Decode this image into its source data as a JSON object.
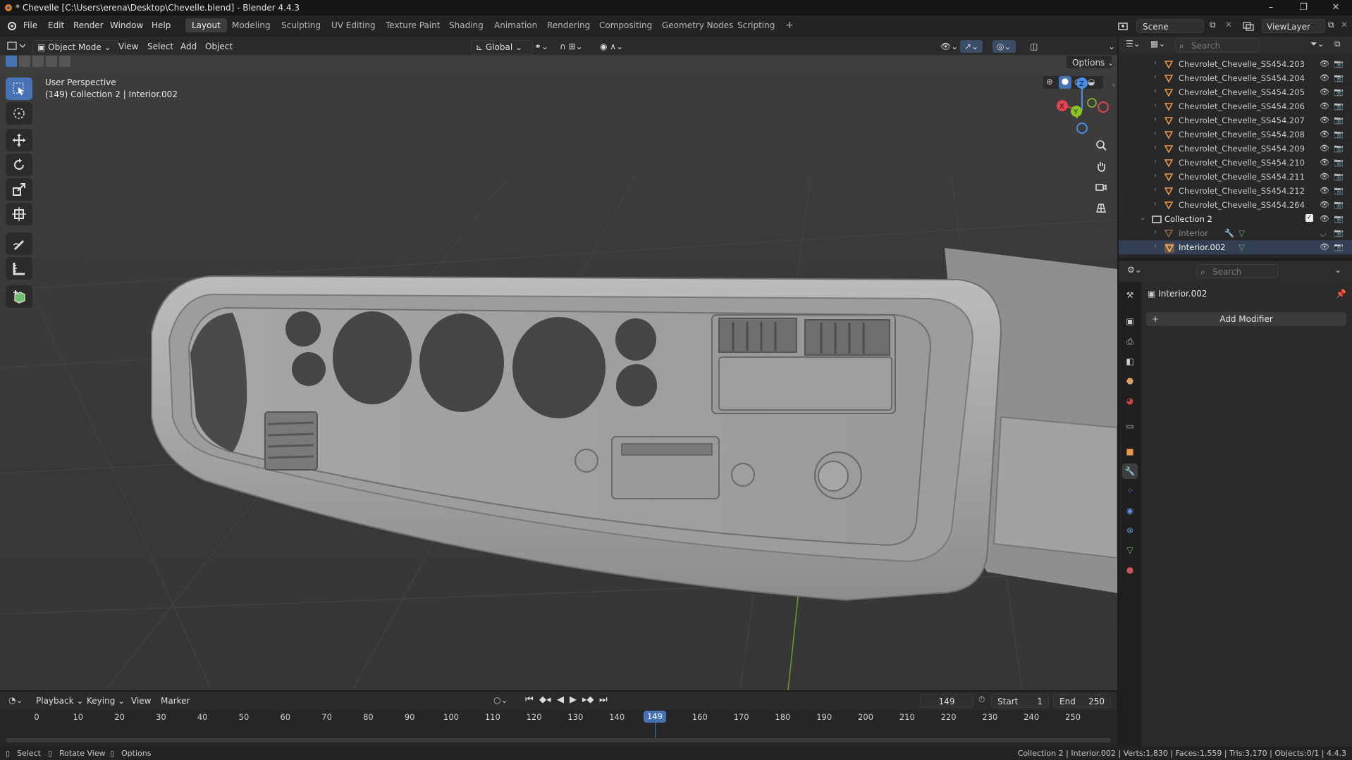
{
  "window": {
    "title": "* Chevelle [C:\\Users\\erena\\Desktop\\Chevelle.blend] - Blender 4.4.3",
    "controls": [
      "–",
      "❐",
      "✕"
    ]
  },
  "topbar": {
    "menus": [
      "File",
      "Edit",
      "Render",
      "Window",
      "Help"
    ],
    "workspaces": [
      "Layout",
      "Modeling",
      "Sculpting",
      "UV Editing",
      "Texture Paint",
      "Shading",
      "Animation",
      "Rendering",
      "Compositing",
      "Geometry Nodes",
      "Scripting"
    ],
    "active_workspace": "Layout",
    "add_workspace": "+",
    "scene_name": "Scene",
    "view_layer": "ViewLayer"
  },
  "viewport": {
    "mode": "Object Mode",
    "menus": [
      "View",
      "Select",
      "Add",
      "Object"
    ],
    "orientation": "Global",
    "options_label": "Options",
    "overlay_line1": "User Perspective",
    "overlay_line2": "(149) Collection 2 | Interior.002",
    "gizmo": {
      "x": "X",
      "y": "Y",
      "z": "Z"
    }
  },
  "outliner": {
    "search_placeholder": "Search",
    "items": [
      {
        "name": "Chevrolet_Chevelle_SS454.203",
        "type": "object"
      },
      {
        "name": "Chevrolet_Chevelle_SS454.204",
        "type": "object"
      },
      {
        "name": "Chevrolet_Chevelle_SS454.205",
        "type": "object"
      },
      {
        "name": "Chevrolet_Chevelle_SS454.206",
        "type": "object"
      },
      {
        "name": "Chevrolet_Chevelle_SS454.207",
        "type": "object"
      },
      {
        "name": "Chevrolet_Chevelle_SS454.208",
        "type": "object"
      },
      {
        "name": "Chevrolet_Chevelle_SS454.209",
        "type": "object"
      },
      {
        "name": "Chevrolet_Chevelle_SS454.210",
        "type": "object"
      },
      {
        "name": "Chevrolet_Chevelle_SS454.211",
        "type": "object"
      },
      {
        "name": "Chevrolet_Chevelle_SS454.212",
        "type": "object"
      },
      {
        "name": "Chevrolet_Chevelle_SS454.264",
        "type": "object"
      },
      {
        "name": "Collection 2",
        "type": "collection"
      },
      {
        "name": "Interior",
        "type": "object-hidden"
      },
      {
        "name": "Interior.002",
        "type": "object-active"
      }
    ]
  },
  "properties": {
    "search_placeholder": "Search",
    "object_name": "Interior.002",
    "add_modifier": "Add Modifier"
  },
  "timeline": {
    "menus": [
      "Playback",
      "Keying",
      "View",
      "Marker"
    ],
    "current_frame": "149",
    "start_label": "Start",
    "start_value": "1",
    "end_label": "End",
    "end_value": "250",
    "ticks": [
      "0",
      "10",
      "20",
      "30",
      "40",
      "50",
      "60",
      "70",
      "80",
      "90",
      "100",
      "110",
      "120",
      "130",
      "140",
      "160",
      "170",
      "180",
      "190",
      "200",
      "210",
      "220",
      "230",
      "240",
      "250"
    ],
    "playhead_label": "149"
  },
  "statusbar": {
    "select": "Select",
    "rotate": "Rotate View",
    "options": "Options",
    "stats": "Collection 2 | Interior.002 | Verts:1,830 | Faces:1,559 | Tris:3,170 | Objects:0/1 | 4.4.3"
  },
  "colors": {
    "accent": "#4772b3",
    "object_icon": "#e59a4a",
    "collection_check": "#ffffff",
    "axis_x": "#e0444e",
    "axis_y": "#8bc524",
    "axis_z": "#4a8ee8"
  }
}
